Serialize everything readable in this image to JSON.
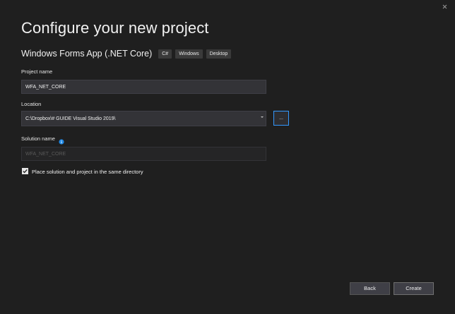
{
  "window": {
    "close_symbol": "×"
  },
  "header": {
    "title": "Configure your new project",
    "template_name": "Windows Forms App (.NET Core)",
    "tags": [
      "C#",
      "Windows",
      "Desktop"
    ]
  },
  "project_name": {
    "label": "Project name",
    "value": "WFA_NET_CORE"
  },
  "location": {
    "label": "Location",
    "value": "C:\\Dropbox\\# GUIDE Visual Studio 2019\\",
    "browse_label": "..."
  },
  "solution_name": {
    "label": "Solution name",
    "placeholder": "WFA_NET_CORE",
    "info_icon": "info-icon"
  },
  "options": {
    "same_directory_label": "Place solution and project in the same directory",
    "same_directory_checked": true
  },
  "footer": {
    "back_label": "Back",
    "create_label": "Create"
  },
  "colors": {
    "background": "#1f1f1f",
    "field_background": "#333337",
    "accent": "#3399ff",
    "info_icon": "#1e88e5"
  }
}
